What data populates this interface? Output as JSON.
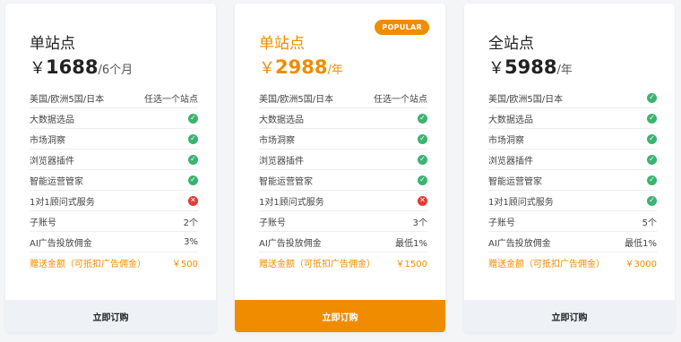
{
  "plans": [
    {
      "title": "单站点",
      "currency": "￥",
      "price": "1688",
      "unit": "/6个月",
      "featured": false,
      "features": [
        {
          "label": "美国/欧洲5国/日本",
          "value": "任选一个站点"
        },
        {
          "label": "大数据选品",
          "icon": "check"
        },
        {
          "label": "市场洞察",
          "icon": "check"
        },
        {
          "label": "浏览器插件",
          "icon": "check"
        },
        {
          "label": "智能运营管家",
          "icon": "check"
        },
        {
          "label": "1对1顾问式服务",
          "icon": "cross"
        },
        {
          "label": "子账号",
          "value": "2个"
        },
        {
          "label": "AI广告投放佣金",
          "value": "3%"
        },
        {
          "label": "赠送金额（可抵扣广告佣金）",
          "value": "￥500"
        }
      ],
      "button": "立即订购"
    },
    {
      "title": "单站点",
      "currency": "￥",
      "price": "2988",
      "unit": "/年",
      "featured": true,
      "badge": "POPULAR",
      "features": [
        {
          "label": "美国/欧洲5国/日本",
          "value": "任选一个站点"
        },
        {
          "label": "大数据选品",
          "icon": "check"
        },
        {
          "label": "市场洞察",
          "icon": "check"
        },
        {
          "label": "浏览器插件",
          "icon": "check"
        },
        {
          "label": "智能运营管家",
          "icon": "check"
        },
        {
          "label": "1对1顾问式服务",
          "icon": "cross"
        },
        {
          "label": "子账号",
          "value": "3个"
        },
        {
          "label": "AI广告投放佣金",
          "value": "最低1%"
        },
        {
          "label": "赠送金额（可抵扣广告佣金）",
          "value": "￥1500"
        }
      ],
      "button": "立即订购"
    },
    {
      "title": "全站点",
      "currency": "￥",
      "price": "5988",
      "unit": "/年",
      "featured": false,
      "features": [
        {
          "label": "美国/欧洲5国/日本",
          "icon": "check"
        },
        {
          "label": "大数据选品",
          "icon": "check"
        },
        {
          "label": "市场洞察",
          "icon": "check"
        },
        {
          "label": "浏览器插件",
          "icon": "check"
        },
        {
          "label": "智能运营管家",
          "icon": "check"
        },
        {
          "label": "1对1顾问式服务",
          "icon": "check"
        },
        {
          "label": "子账号",
          "value": "5个"
        },
        {
          "label": "AI广告投放佣金",
          "value": "最低1%"
        },
        {
          "label": "赠送金额（可抵扣广告佣金）",
          "value": "￥3000"
        }
      ],
      "button": "立即订购"
    }
  ],
  "colors": {
    "accent": "#f08c00",
    "check": "#3cb371",
    "cross": "#e53935"
  }
}
